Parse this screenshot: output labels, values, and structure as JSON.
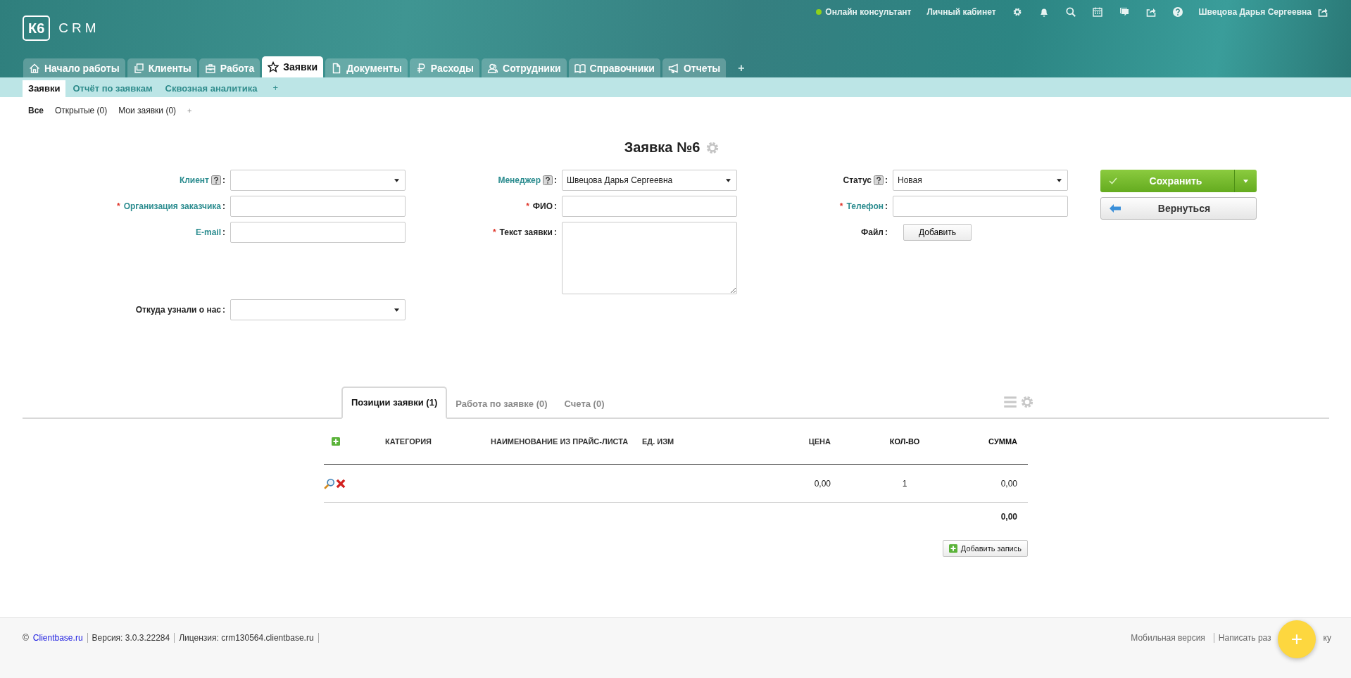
{
  "logo": {
    "badge": "К6",
    "text": "CRM"
  },
  "top_bar": {
    "online": "Онлайн консультант",
    "account": "Личный кабинет",
    "user": "Швецова Дарья Сергеевна"
  },
  "main_tabs": [
    {
      "label": "Начало работы",
      "kind": "home",
      "selected": false
    },
    {
      "label": "Клиенты",
      "kind": "copy",
      "selected": false
    },
    {
      "label": "Работа",
      "kind": "case",
      "selected": false
    },
    {
      "label": "Заявки",
      "kind": "star",
      "selected": true
    },
    {
      "label": "Документы",
      "kind": "doc",
      "selected": false
    },
    {
      "label": "Расходы",
      "kind": "ruble",
      "selected": false
    },
    {
      "label": "Сотрудники",
      "kind": "people",
      "selected": false
    },
    {
      "label": "Справочники",
      "kind": "book",
      "selected": false
    },
    {
      "label": "Отчеты",
      "kind": "horn",
      "selected": false
    }
  ],
  "main_tabs_add": "+",
  "sub_tabs": [
    {
      "label": "Заявки",
      "selected": true
    },
    {
      "label": "Отчёт по заявкам",
      "selected": false
    },
    {
      "label": "Сквозная аналитика",
      "selected": false
    }
  ],
  "sub_tabs_add": "+",
  "filters": [
    {
      "label": "Все",
      "selected": true
    },
    {
      "label": "Открытые (0)",
      "selected": false
    },
    {
      "label": "Мои заявки (0)",
      "selected": false
    }
  ],
  "filters_add": "+",
  "title": "Заявка №6",
  "required_mark": "*",
  "label_suffix": ":",
  "field_columns": [
    [
      {
        "label": "Клиент",
        "kind": "select",
        "link": true,
        "help": true,
        "required": false
      },
      {
        "label": "Организация заказчика",
        "kind": "input",
        "link": true,
        "help": false,
        "required": true
      },
      {
        "label": "E-mail",
        "kind": "input",
        "link": true,
        "help": false,
        "required": false
      }
    ],
    [
      {
        "label": "Менеджер",
        "kind": "select",
        "link": true,
        "help": true,
        "required": false,
        "value": "Швецова Дарья Сергеевна"
      },
      {
        "label": "ФИО",
        "kind": "input",
        "link": false,
        "help": false,
        "required": true
      },
      {
        "label": "Текст заявки",
        "kind": "textarea",
        "link": false,
        "help": false,
        "required": true
      }
    ],
    [
      {
        "label": "Статус",
        "kind": "select",
        "link": false,
        "help": true,
        "required": false,
        "value": "Новая"
      },
      {
        "label": "Телефон",
        "kind": "input",
        "link": true,
        "help": false,
        "required": true
      },
      {
        "label": "Файл",
        "kind": "file",
        "link": false,
        "help": false,
        "required": false,
        "button": "Добавить"
      }
    ]
  ],
  "source_field": {
    "label": "Откуда узнали о нас",
    "kind": "select",
    "link": false
  },
  "actions": {
    "save": "Сохранить",
    "back": "Вернуться"
  },
  "detail_tabs": [
    {
      "label": "Позиции заявки (1)",
      "selected": true
    },
    {
      "label": "Работа по заявке (0)",
      "selected": false
    },
    {
      "label": "Счета (0)",
      "selected": false
    }
  ],
  "table": {
    "columns": [
      "КАТЕГОРИЯ",
      "НАИМЕНОВАНИЕ ИЗ ПРАЙС-ЛИСТА",
      "ЕД. ИЗМ",
      "ЦЕНА",
      "КОЛ-ВО",
      "СУММА"
    ],
    "rows": [
      {
        "price": "0,00",
        "quantity": "1",
        "sum": "0,00"
      }
    ],
    "total": "0,00",
    "add_button": "Добавить запись"
  },
  "footer": {
    "copyright": "©",
    "site": "Clientbase.ru",
    "version": "Версия: 3.0.3.22284",
    "license": "Лицензия: crm130564.clientbase.ru",
    "mobile": "Мобильная версия",
    "write_start": "Написать раз",
    "write_end": "ку",
    "fab": "+"
  }
}
